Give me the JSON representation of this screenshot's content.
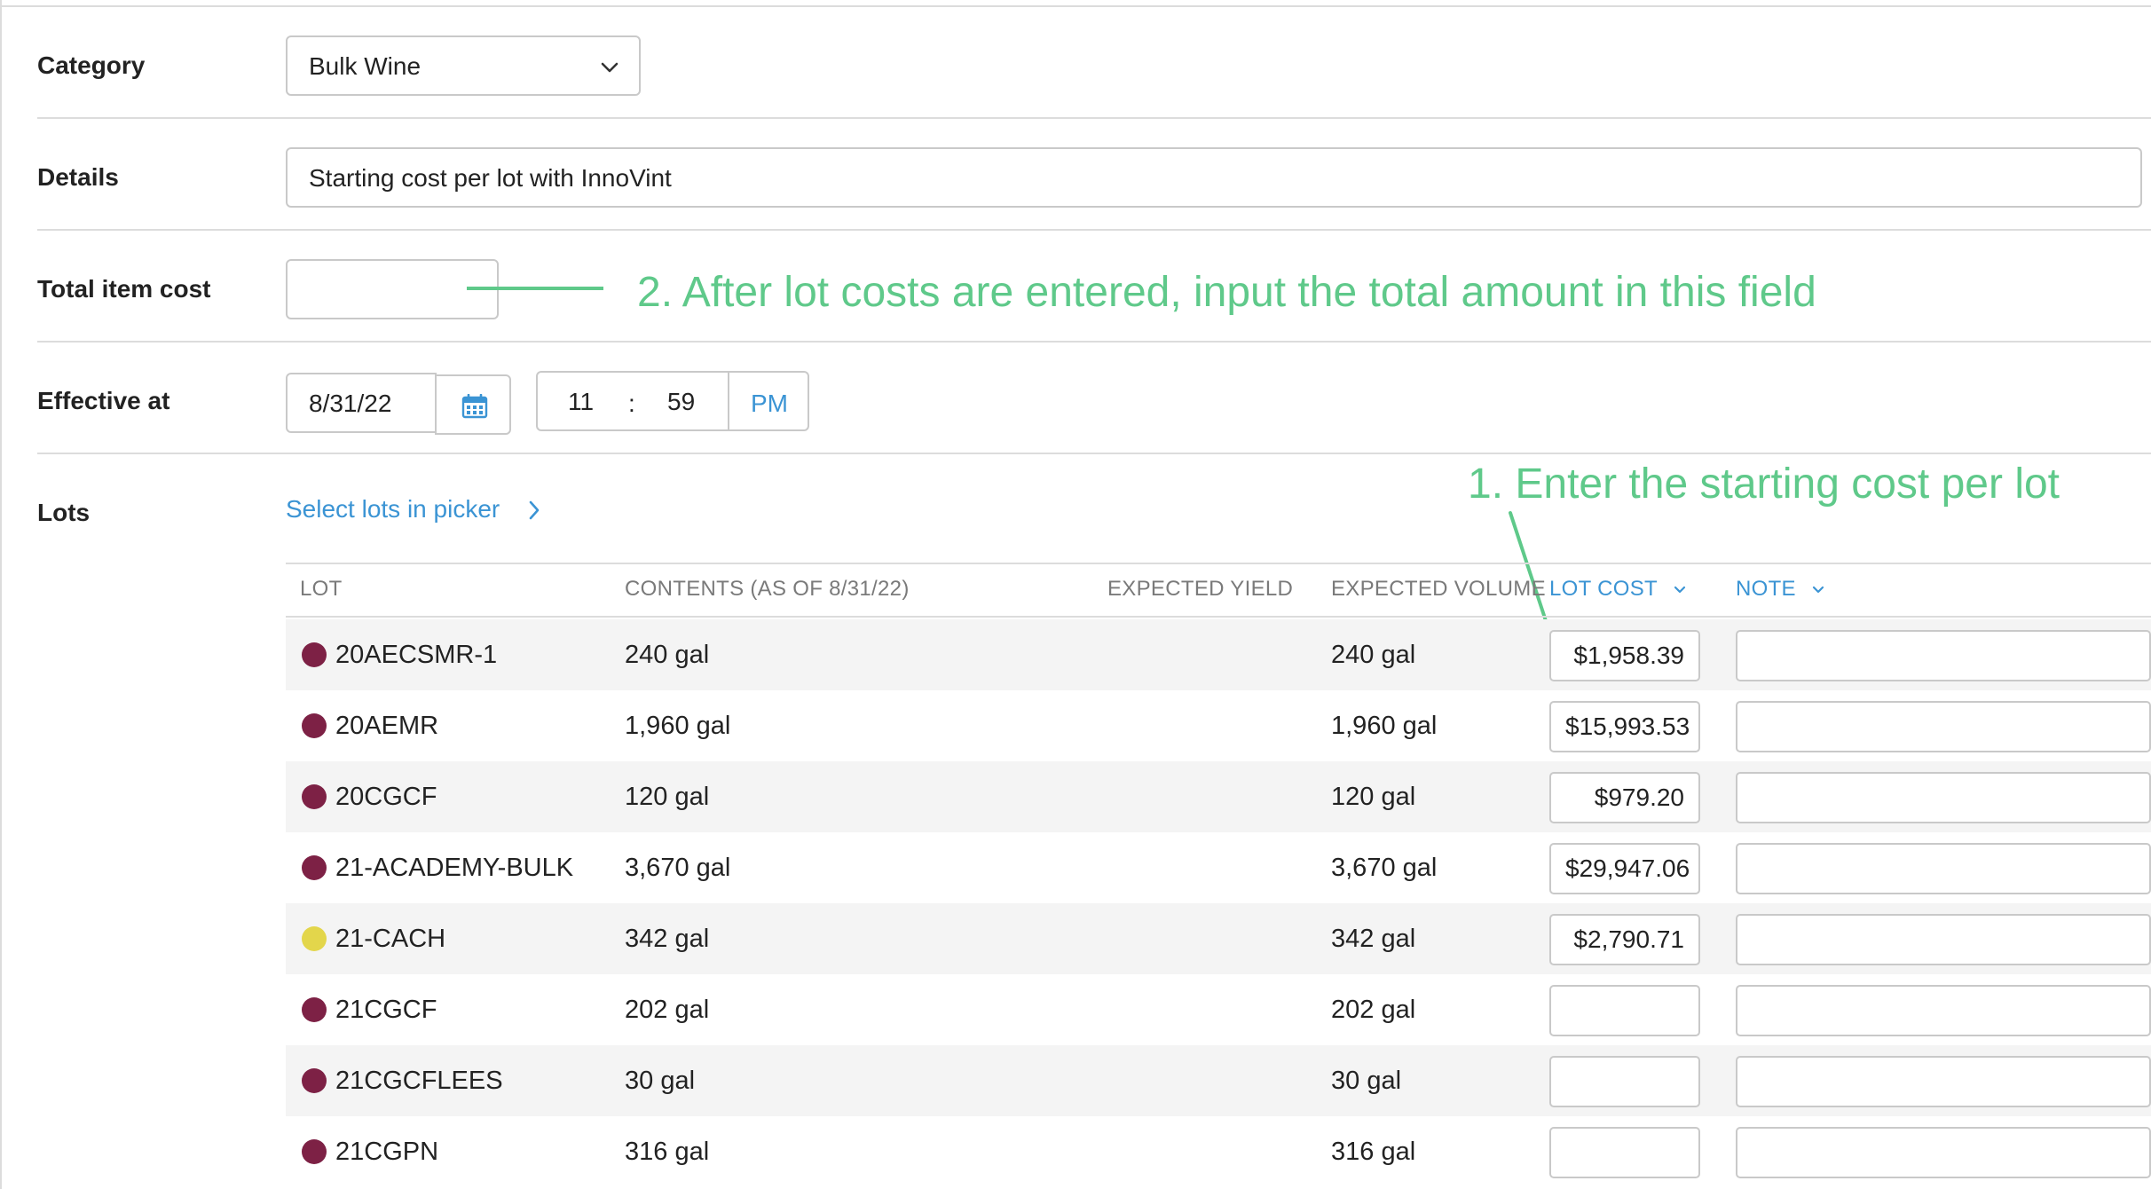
{
  "form": {
    "category": {
      "label": "Category",
      "value": "Bulk Wine"
    },
    "details": {
      "label": "Details",
      "value": "Starting cost per lot with InnoVint"
    },
    "total_item_cost": {
      "label": "Total item cost",
      "value": ""
    },
    "effective_at": {
      "label": "Effective at",
      "date": "8/31/22",
      "hour": "11",
      "separator": ":",
      "minute": "59",
      "meridiem": "PM"
    },
    "lots": {
      "label": "Lots",
      "picker_link": "Select lots in picker"
    }
  },
  "annotations": {
    "step1": "1. Enter the starting cost per lot",
    "step2": "2. After lot costs are entered, input the total amount in this field"
  },
  "table": {
    "headers": {
      "lot": "LOT",
      "contents": "CONTENTS (AS OF 8/31/22)",
      "expected_yield": "EXPECTED YIELD",
      "expected_volume": "EXPECTED VOLUME",
      "lot_cost": "LOT COST",
      "note": "NOTE"
    },
    "rows": [
      {
        "lot": "20AECSMR-1",
        "color": "#7d2145",
        "contents": "240 gal",
        "expected_yield": "",
        "expected_volume": "240 gal",
        "lot_cost": "$1,958.39",
        "note": ""
      },
      {
        "lot": "20AEMR",
        "color": "#7d2145",
        "contents": "1,960 gal",
        "expected_yield": "",
        "expected_volume": "1,960 gal",
        "lot_cost": "$15,993.53",
        "note": ""
      },
      {
        "lot": "20CGCF",
        "color": "#7d2145",
        "contents": "120 gal",
        "expected_yield": "",
        "expected_volume": "120 gal",
        "lot_cost": "$979.20",
        "note": ""
      },
      {
        "lot": "21-ACADEMY-BULK",
        "color": "#7d2145",
        "contents": "3,670 gal",
        "expected_yield": "",
        "expected_volume": "3,670 gal",
        "lot_cost": "$29,947.06",
        "note": ""
      },
      {
        "lot": "21-CACH",
        "color": "#e3d64b",
        "contents": "342 gal",
        "expected_yield": "",
        "expected_volume": "342 gal",
        "lot_cost": "$2,790.71",
        "note": ""
      },
      {
        "lot": "21CGCF",
        "color": "#7d2145",
        "contents": "202 gal",
        "expected_yield": "",
        "expected_volume": "202 gal",
        "lot_cost": "",
        "note": ""
      },
      {
        "lot": "21CGCFLEES",
        "color": "#7d2145",
        "contents": "30 gal",
        "expected_yield": "",
        "expected_volume": "30 gal",
        "lot_cost": "",
        "note": ""
      },
      {
        "lot": "21CGPN",
        "color": "#7d2145",
        "contents": "316 gal",
        "expected_yield": "",
        "expected_volume": "316 gal",
        "lot_cost": "",
        "note": ""
      }
    ]
  },
  "colors": {
    "accent_blue": "#3b94d4",
    "annotation_green": "#5fc98a",
    "wine_red": "#7d2145",
    "white_wine_yellow": "#e3d64b"
  }
}
